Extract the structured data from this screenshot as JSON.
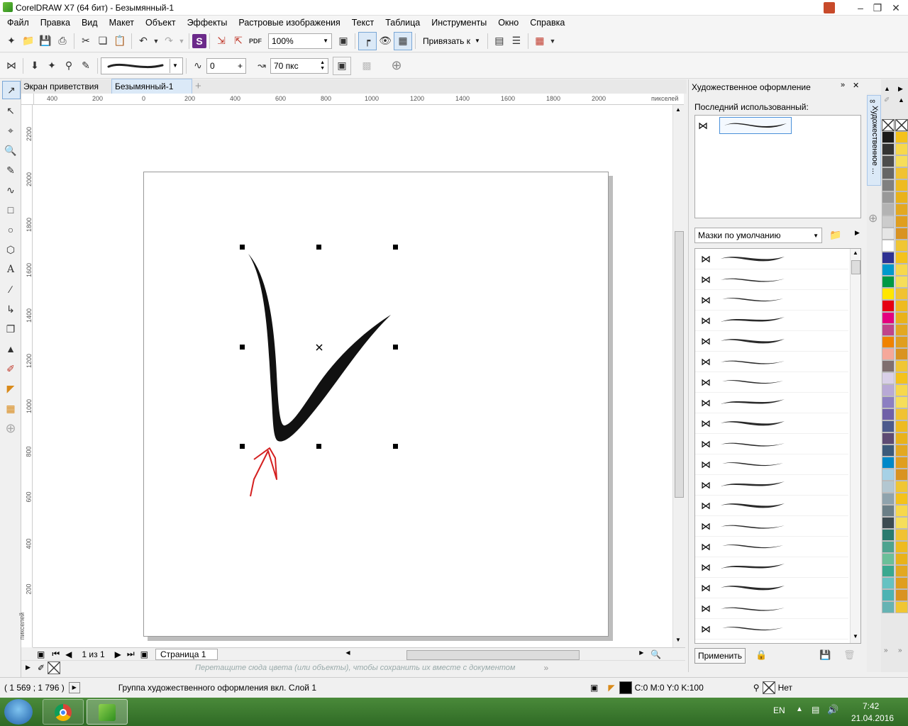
{
  "app": {
    "title": "CorelDRAW X7 (64 бит) - Безымянный-1"
  },
  "menu": [
    "Файл",
    "Правка",
    "Вид",
    "Макет",
    "Объект",
    "Эффекты",
    "Растровые изображения",
    "Текст",
    "Таблица",
    "Инструменты",
    "Окно",
    "Справка"
  ],
  "std_toolbar": {
    "zoom_value": "100%",
    "snap_label": "Привязать к"
  },
  "prop_toolbar": {
    "smoothing_value": "0",
    "width_value": "70 пкс"
  },
  "doc_tabs": [
    "Экран приветствия",
    "Безымянный-1"
  ],
  "ruler": {
    "unit": "пикселей",
    "h_ticks": [
      "400",
      "200",
      "0",
      "200",
      "400",
      "600",
      "800",
      "1000",
      "1200",
      "1400",
      "1600",
      "1800",
      "2000"
    ],
    "v_ticks": [
      "2200",
      "2000",
      "1800",
      "1600",
      "1400",
      "1200",
      "1000",
      "800",
      "600",
      "400",
      "200"
    ]
  },
  "page_nav": {
    "page_count": "1 из 1",
    "page_tab": "Страница 1"
  },
  "palette_hint": "Перетащите сюда цвета (или объекты), чтобы сохранить их вместе с документом",
  "docker": {
    "title": "Художественное оформление",
    "side_tab": "Художественное ...",
    "recent_label": "Последний использованный:",
    "category": "Мазки по умолчанию",
    "apply_label": "Применить",
    "brush_count": 20
  },
  "palette_colors": [
    "#1a1a1a",
    "#333333",
    "#4d4d4d",
    "#666666",
    "#808080",
    "#999999",
    "#b3b3b3",
    "#cccccc",
    "#e6e6e6",
    "#ffffff",
    "#2e3192",
    "#0099cc",
    "#009944",
    "#ffe600",
    "#e60012",
    "#e4007f",
    "#c0458a",
    "#f08300",
    "#f5a89a",
    "#7f6f6f",
    "#d9d0e8",
    "#b8a9d6",
    "#8c7fc2",
    "#7060a8",
    "#4c5a8c",
    "#5e4b73",
    "#3c5a7a",
    "#0088c8",
    "#a6d1e6",
    "#b3c7d1",
    "#8fa3ad",
    "#6b7f87",
    "#3d4c52",
    "#2a7a6e",
    "#4ea38f",
    "#6bbf99",
    "#3aa88f",
    "#66c2c2",
    "#4db3b3",
    "#66b3b3"
  ],
  "palette_colors2": [
    "#f4c21b",
    "#f7d84c",
    "#f6de5a",
    "#f1c232",
    "#eebb20",
    "#e9b21a",
    "#e3a821",
    "#e09e1f",
    "#d99321",
    "#f0c634"
  ],
  "status": {
    "coords": "( 1 569 ; 1 796  )",
    "info": "Группа художественного оформления вкл. Слой 1",
    "fill": "C:0 M:0 Y:0 K:100",
    "outline": "Нет"
  },
  "taskbar": {
    "lang": "EN",
    "time": "7:42",
    "date": "21.04.2016"
  }
}
